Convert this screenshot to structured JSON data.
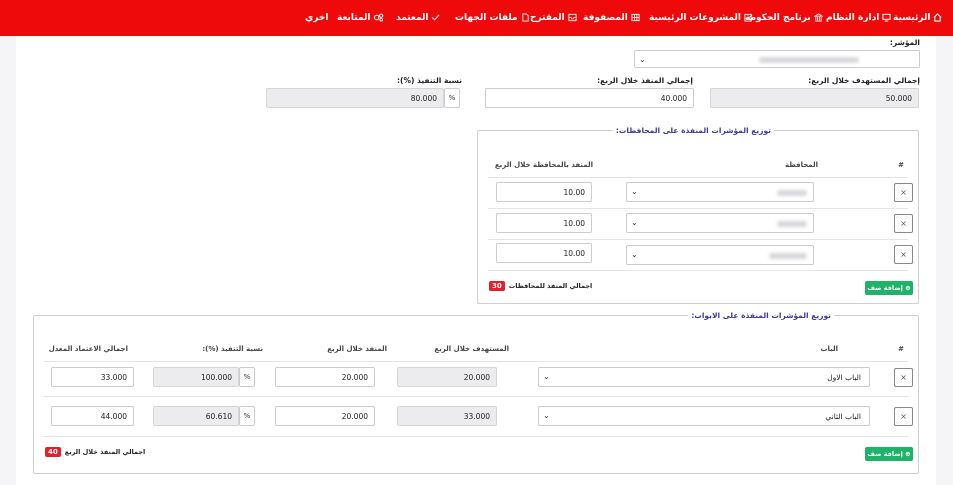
{
  "nav": {
    "items": [
      {
        "label": "الرئيسية",
        "icon": "home-icon"
      },
      {
        "label": "ادارة النظام",
        "icon": "monitor-icon"
      },
      {
        "label": "برنامج الحكومة",
        "icon": "building-icon"
      },
      {
        "label": "المشروعات الرئيسية",
        "icon": "checklist-icon"
      },
      {
        "label": "المصفوفة",
        "icon": "grid-icon"
      },
      {
        "label": "المقترح",
        "icon": "inbox-icon"
      },
      {
        "label": "ملفات الجهات",
        "icon": "file-icon"
      },
      {
        "label": "المعتمد",
        "icon": "check-icon"
      },
      {
        "label": "المتابعة",
        "icon": "gears-icon"
      },
      {
        "label": "اخري",
        "icon": ""
      }
    ]
  },
  "indicator": {
    "label": "المؤشر:"
  },
  "quarter": {
    "target_label": "إجمالي المستهدف خلال الربع:",
    "target_value": "50.000",
    "achieved_label": "إجمالي المنفذ خلال الربع:",
    "achieved_value": "40.000",
    "rate_label": "نسبة التنفيذ (%):",
    "rate_value": "80.000",
    "rate_unit": "%"
  },
  "governorates": {
    "title": "توزيع المؤشرات المنفذة على المحافظات:",
    "col_num": "#",
    "col_gov": "المحافظة",
    "col_achieved": "المنفذ بالمحافظة خلال الربع",
    "rows": [
      {
        "value": "10.00",
        "remove": "×"
      },
      {
        "value": "10.00",
        "remove": "×"
      },
      {
        "value": "10.00",
        "remove": "×"
      }
    ],
    "add_label": "إضافة صف",
    "total_label": "اجمالي المنفذ للمحافظات",
    "total_value": "30"
  },
  "chapters": {
    "title": "توزيع المؤشرات المنفذة على الابواب:",
    "col_num": "#",
    "col_chapter": "الباب",
    "col_target": "المستهدف خلال الربع",
    "col_achieved": "المنفذ خلال الربع",
    "col_rate": "نسبة التنفيذ (%):",
    "col_approved": "اجمالي الاعتماد المعدل",
    "rows": [
      {
        "chapter": "الباب الاول",
        "target": "20.000",
        "achieved": "20.000",
        "rate": "100.000",
        "unit": "%",
        "approved": "33.000",
        "remove": "×"
      },
      {
        "chapter": "الباب الثاني",
        "target": "33.000",
        "achieved": "20.000",
        "rate": "60.610",
        "unit": "%",
        "approved": "44.000",
        "remove": "×"
      }
    ],
    "add_label": "إضافة صف",
    "total_label": "اجمالي المنفذ خلال الربع",
    "total_value": "40"
  }
}
